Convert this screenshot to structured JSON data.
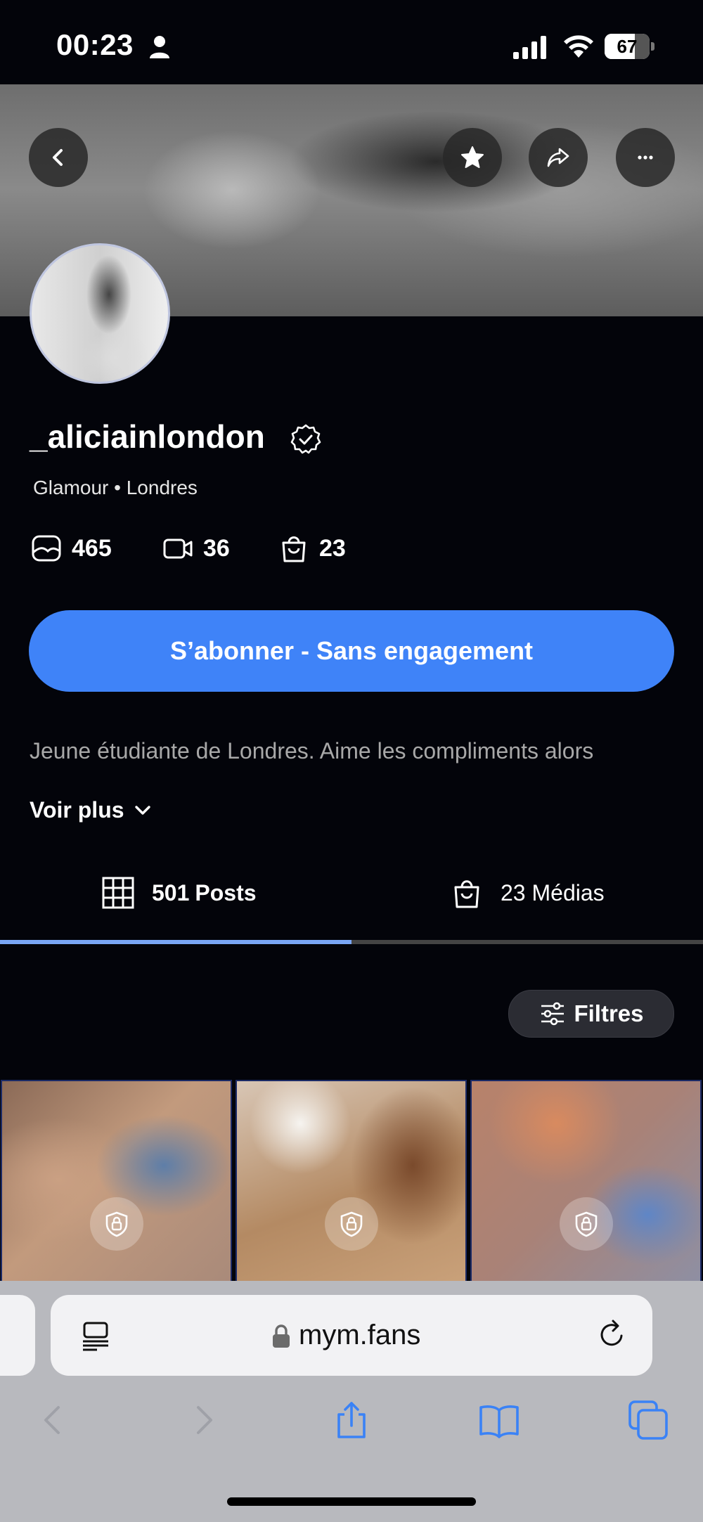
{
  "status_bar": {
    "time": "00:23",
    "battery": "67",
    "battery_level": 0.67
  },
  "profile": {
    "username": "_aliciainlondon",
    "subtitle": "Glamour • Londres",
    "stats": {
      "photos": "465",
      "videos": "36",
      "purchases": "23"
    },
    "subscribe_label": "S’abonner - Sans engagement",
    "bio": "Jeune étudiante de Londres. Aime les compliments alors",
    "see_more": "Voir plus"
  },
  "tabs": [
    {
      "count": "501",
      "label": "Posts",
      "active": true
    },
    {
      "label": "23 Médias",
      "active": false
    }
  ],
  "filters_label": "Filtres",
  "browser": {
    "url": "mym.fans"
  },
  "colors": {
    "accent": "#3f83f8",
    "background": "#03040a",
    "tab_indicator": "#7aa6f5",
    "safari_blue": "#3a82f6"
  }
}
